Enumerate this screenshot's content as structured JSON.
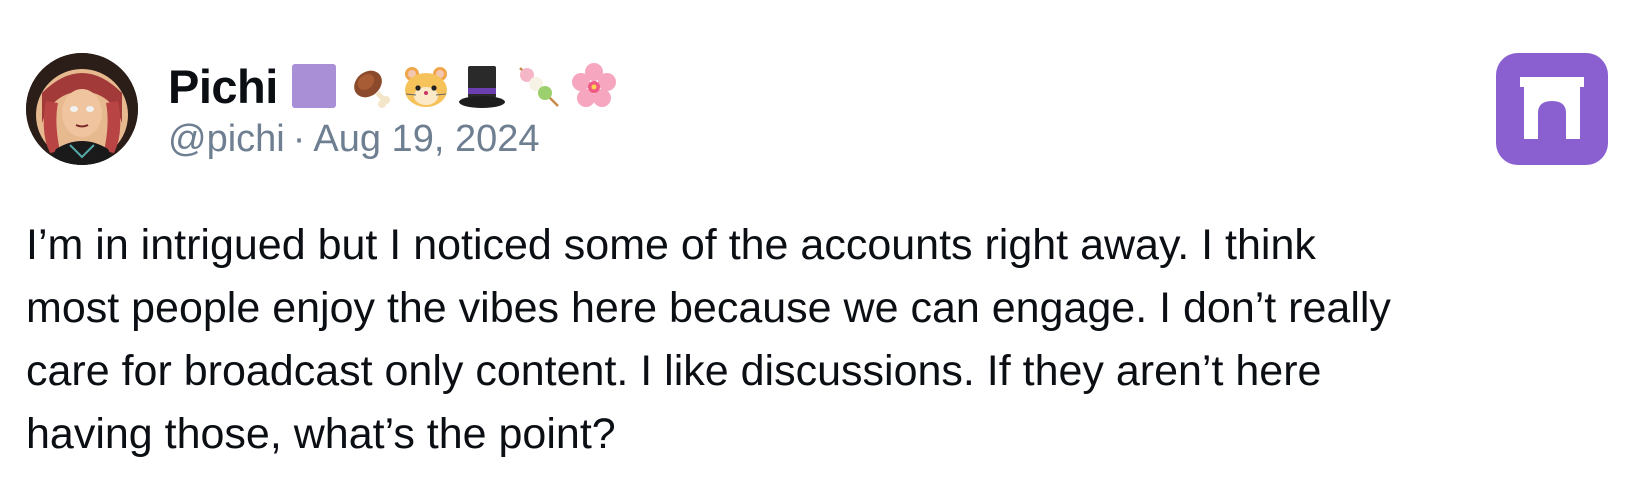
{
  "post": {
    "author": {
      "display_name": "Pichi",
      "name_emojis": [
        "purple-square",
        "meat-on-bone",
        "hamster-face",
        "top-hat",
        "dango",
        "cherry-blossom"
      ],
      "handle": "@pichi",
      "separator": "·",
      "date": "Aug 19, 2024"
    },
    "text": "I’m in intrigued but I noticed some of the accounts right away.  I think\nmost people enjoy the vibes here because we can engage. I don’t really\ncare for broadcast only content. I like discussions. If they aren’t here\nhaving those, what’s the point?",
    "app_logo": "archway-logo-icon"
  },
  "colors": {
    "logo_bg": "#8a5fd0",
    "meta_text": "#6f7f92",
    "body_text": "#0b0f14"
  }
}
